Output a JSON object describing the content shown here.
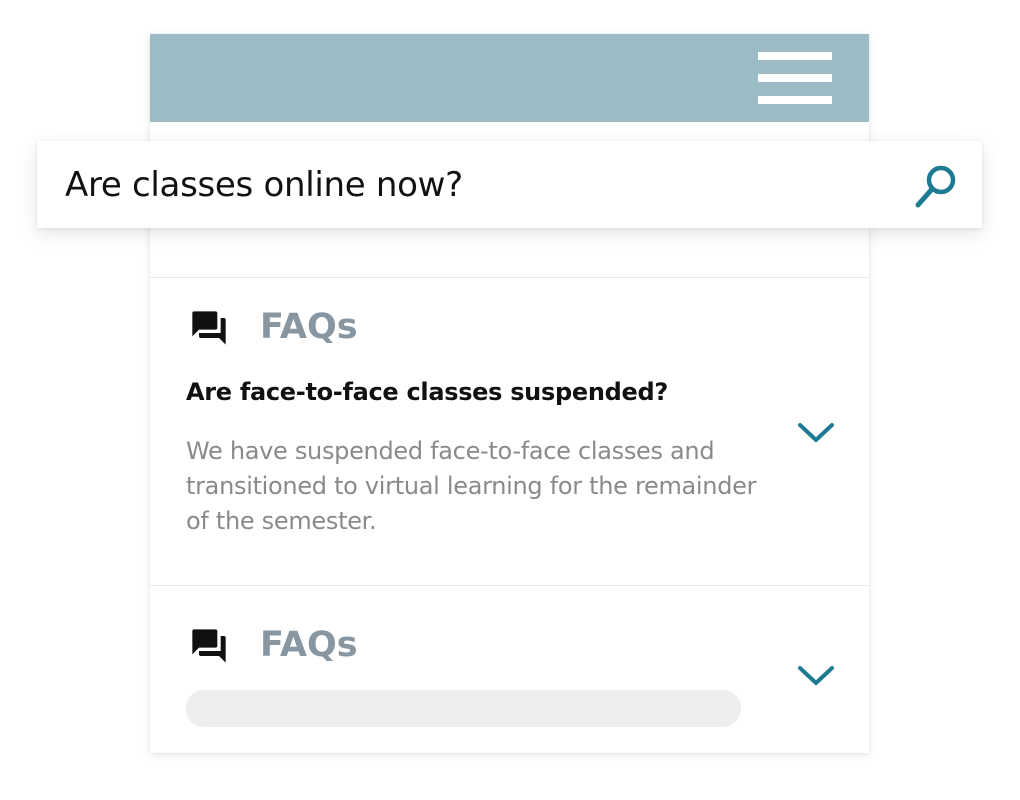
{
  "header": {
    "menu_icon": "hamburger-menu-icon",
    "background_color": "#9bbcc5"
  },
  "search": {
    "value": "Are classes online now?",
    "icon": "search-icon",
    "accent_color": "#1d7a93"
  },
  "faqs": [
    {
      "icon": "forum-chat-icon",
      "heading": "FAQs",
      "question": "Are face-to-face classes suspended?",
      "answer": "We have suspended face-to-face classes and transitioned to virtual learning for the remainder of the semester.",
      "expand_icon": "chevron-down-icon"
    },
    {
      "icon": "forum-chat-icon",
      "heading": "FAQs",
      "expand_icon": "chevron-down-icon"
    }
  ],
  "colors": {
    "heading": "#8796a1",
    "question": "#111111",
    "answer": "#8a8a8a",
    "chevron": "#1d7a93",
    "skeleton": "#eceef0"
  }
}
